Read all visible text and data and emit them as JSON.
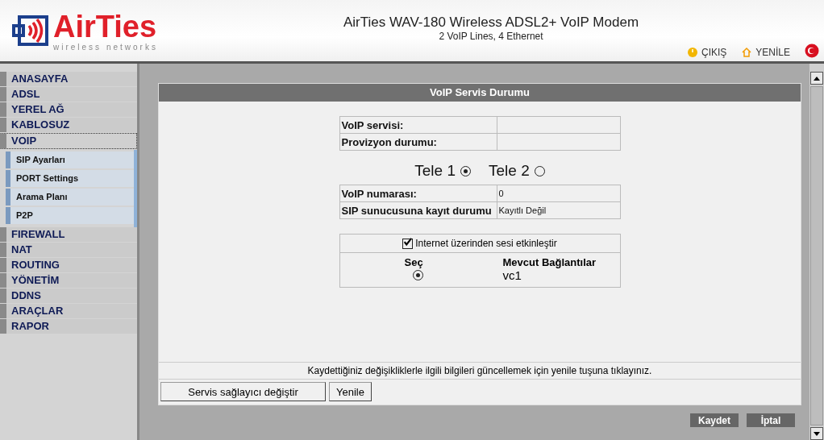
{
  "header": {
    "brand": "AirTies",
    "tagline": "wireless networks",
    "title": "AirTies WAV-180 Wireless ADSL2+ VoIP Modem",
    "subtitle": "2 VoIP Lines, 4 Ethernet",
    "links": [
      {
        "kind": "power",
        "label": "ÇIKIŞ"
      },
      {
        "kind": "home",
        "label": "YENİLE"
      },
      {
        "kind": "flag"
      }
    ]
  },
  "sidebar": {
    "items": [
      {
        "label": "ANASAYFA",
        "selected": false
      },
      {
        "label": "ADSL",
        "selected": false
      },
      {
        "label": "YEREL AĞ",
        "selected": false
      },
      {
        "label": "KABLOSUZ",
        "selected": false
      },
      {
        "label": "VOIP",
        "selected": true,
        "children": [
          {
            "label": "SIP Ayarları"
          },
          {
            "label": "PORT Settings"
          },
          {
            "label": "Arama Planı"
          },
          {
            "label": "P2P"
          }
        ]
      },
      {
        "label": "FIREWALL",
        "selected": false
      },
      {
        "label": "NAT",
        "selected": false
      },
      {
        "label": "ROUTING",
        "selected": false
      },
      {
        "label": "YÖNETİM",
        "selected": false
      },
      {
        "label": "DDNS",
        "selected": false
      },
      {
        "label": "ARAÇLAR",
        "selected": false
      },
      {
        "label": "RAPOR",
        "selected": false
      }
    ]
  },
  "panel": {
    "title": "VoIP Servis Durumu",
    "service_rows": [
      {
        "label": "VoIP servisi:"
      },
      {
        "label": "Provizyon durumu:"
      }
    ],
    "lines": [
      {
        "label": "Tele 1",
        "selected": true
      },
      {
        "label": "Tele 2",
        "selected": false
      }
    ],
    "line_rows": [
      {
        "label": "VoIP numarası:",
        "value": "0"
      },
      {
        "label": "SIP sunucusuna kayıt durumu",
        "value": "Kayıtlı Değil"
      }
    ],
    "voice": {
      "label": "Internet üzerinden sesi etkinleştir",
      "checked": true
    },
    "connections": {
      "columns": [
        "Seç",
        "Mevcut Bağlantılar"
      ],
      "rows": [
        {
          "name": "vc1",
          "selected": true
        }
      ]
    },
    "note": "Kaydettiğiniz değişikliklerle ilgili bilgileri güncellemek için yenile tuşuna tıklayınız.",
    "buttons": [
      "Servis sağlayıcı değiştir",
      "Yenile"
    ]
  },
  "footer_buttons": [
    "Kaydet",
    "İptal"
  ]
}
